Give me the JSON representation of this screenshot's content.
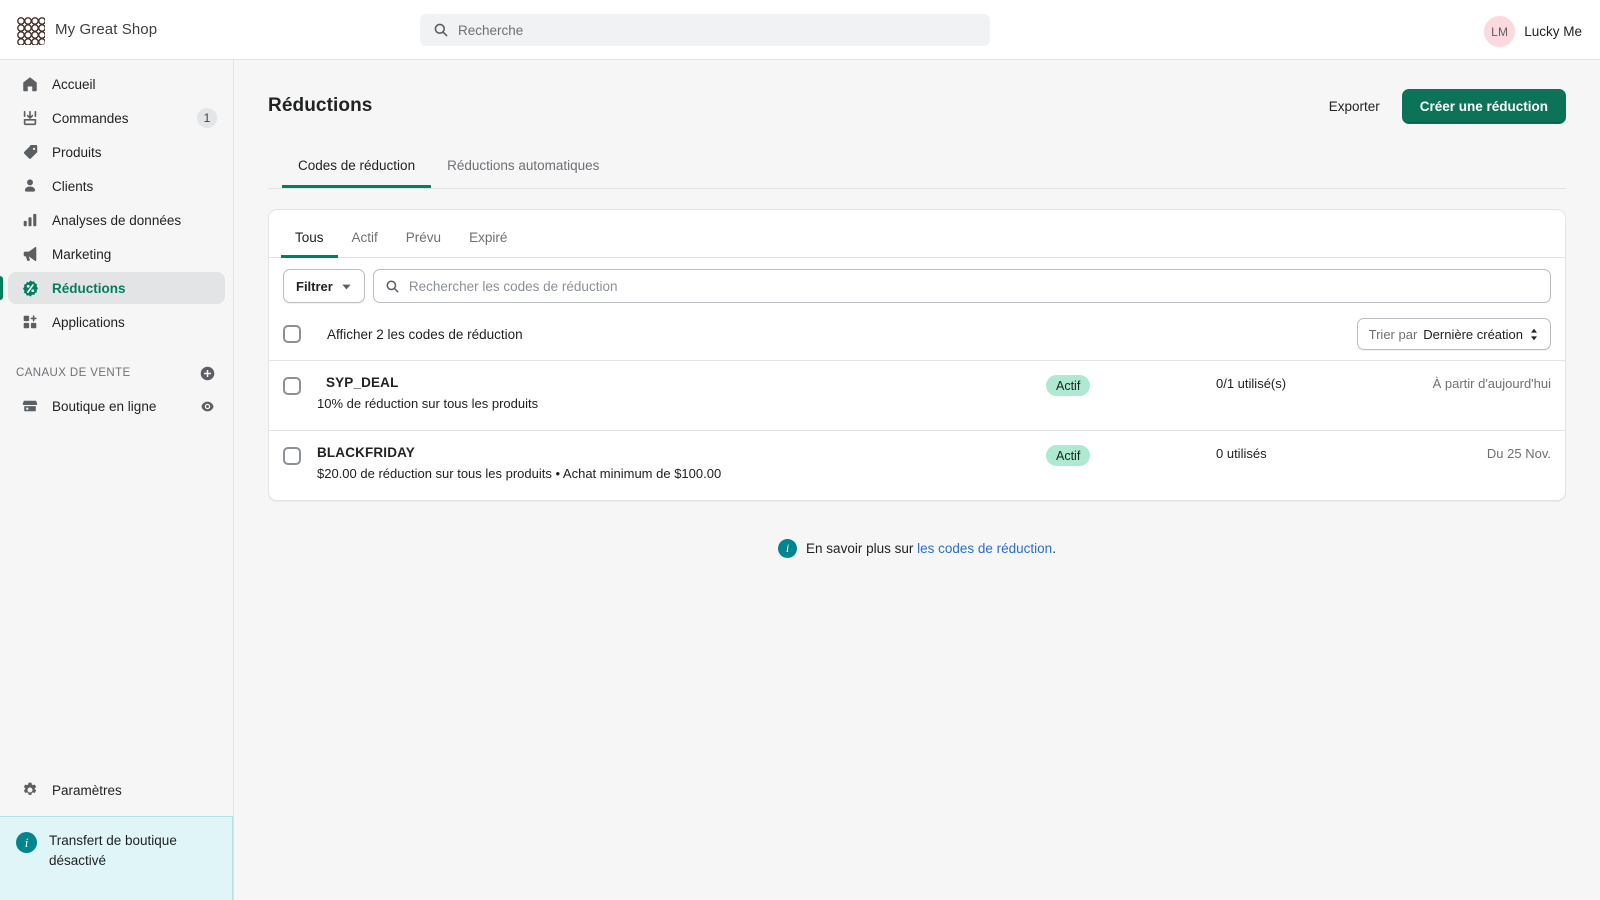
{
  "topbar": {
    "brand_name": "My Great Shop",
    "search_placeholder": "Recherche",
    "user_initials": "LM",
    "user_name": "Lucky Me"
  },
  "sidebar": {
    "items": [
      {
        "label": "Accueil",
        "icon": "home-icon",
        "badge": ""
      },
      {
        "label": "Commandes",
        "icon": "orders-icon",
        "badge": "1"
      },
      {
        "label": "Produits",
        "icon": "products-tag-icon",
        "badge": ""
      },
      {
        "label": "Clients",
        "icon": "customers-person-icon",
        "badge": ""
      },
      {
        "label": "Analyses de données",
        "icon": "analytics-bars-icon",
        "badge": ""
      },
      {
        "label": "Marketing",
        "icon": "marketing-megaphone-icon",
        "badge": ""
      },
      {
        "label": "Réductions",
        "icon": "discounts-percent-icon",
        "badge": ""
      },
      {
        "label": "Applications",
        "icon": "apps-grid-plus-icon",
        "badge": ""
      }
    ],
    "active_item": "Réductions",
    "sales_channels": {
      "title": "CANAUX DE VENTE",
      "add_icon": "plus-circle-icon",
      "items": [
        {
          "label": "Boutique en ligne",
          "icon": "storefront-icon",
          "trailing_icon": "eye-icon"
        }
      ]
    },
    "settings": {
      "label": "Paramètres",
      "icon": "gear-icon"
    },
    "banner": {
      "icon": "info-circle-icon",
      "text": "Transfert de boutique désactivé"
    }
  },
  "page": {
    "title": "Réductions",
    "export_label": "Exporter",
    "create_label": "Créer une réduction",
    "tabs": [
      {
        "label": "Codes de réduction",
        "active": true
      },
      {
        "label": "Réductions automatiques",
        "active": false
      }
    ]
  },
  "card": {
    "tabs": [
      {
        "label": "Tous",
        "active": true
      },
      {
        "label": "Actif",
        "active": false
      },
      {
        "label": "Prévu",
        "active": false
      },
      {
        "label": "Expiré",
        "active": false
      }
    ],
    "filter_label": "Filtrer",
    "filter_chevron_icon": "chevron-down-icon",
    "search_placeholder": "Rechercher les codes de réduction",
    "search_icon": "search-icon",
    "select_all_label": "Afficher 2 les codes de réduction",
    "sort": {
      "prefix": "Trier par ",
      "value": "Dernière création",
      "icon": "sort-updown-icon"
    },
    "rows": [
      {
        "code": "SYP_DEAL",
        "description": "10% de réduction sur tous les produits",
        "status": "Actif",
        "usage": "0/1 utilisé(s)",
        "date": "À partir d'aujourd'hui",
        "indented": true
      },
      {
        "code": "BLACKFRIDAY",
        "description": "$20.00 de réduction sur tous les produits • Achat minimum de $100.00",
        "status": "Actif",
        "usage": "0 utilisés",
        "date": "Du 25 Nov.",
        "indented": false
      }
    ],
    "footer": {
      "icon": "info-circle-icon",
      "text_before": "En savoir plus sur ",
      "link_text": "les codes de réduction",
      "text_after": "."
    }
  },
  "colors": {
    "brand_green": "#0c7358",
    "active_green": "#007f5f",
    "badge_green": "#aee9d1",
    "link_blue": "#2c6ecb",
    "info_teal": "#00848e",
    "avatar_pink": "#fcd9dd"
  }
}
